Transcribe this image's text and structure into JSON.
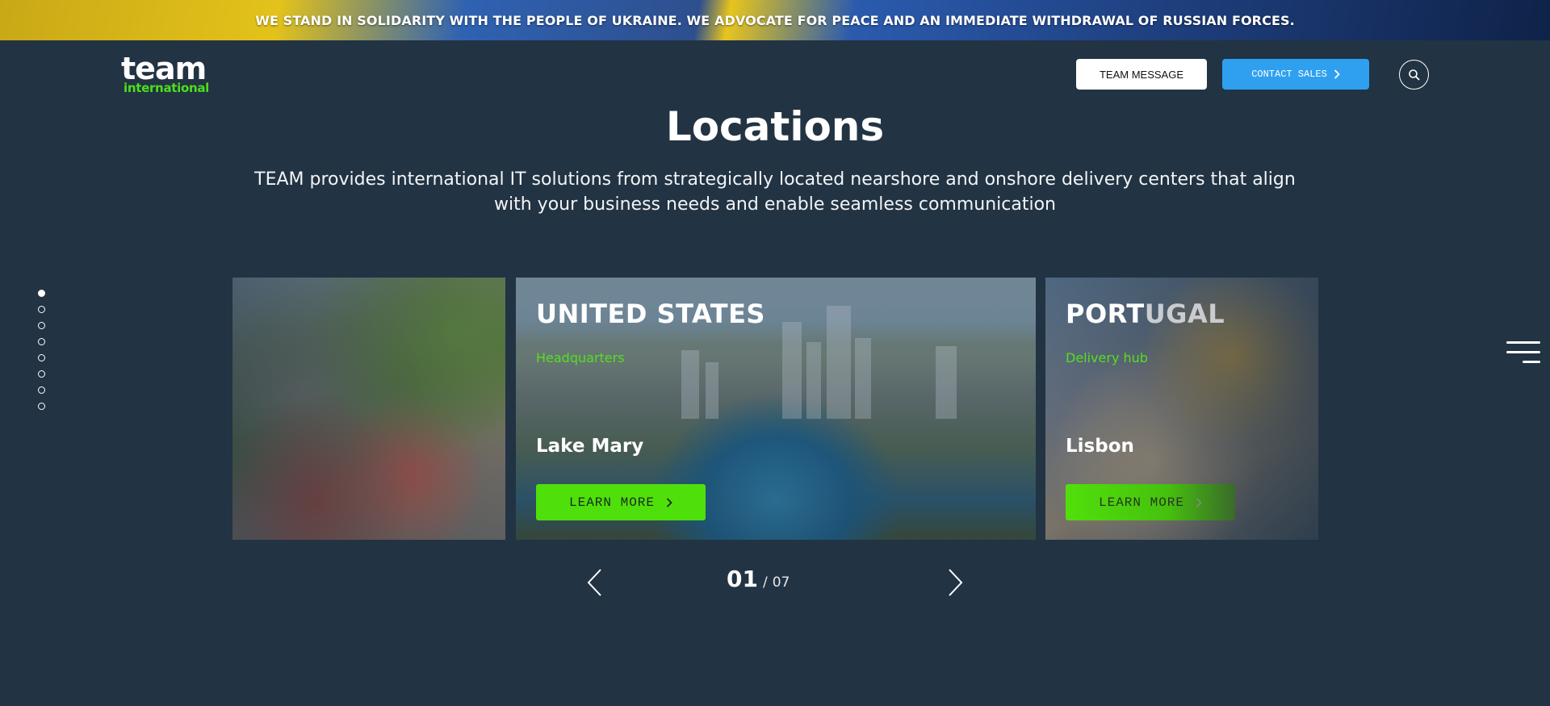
{
  "banner": {
    "text": "WE STAND IN SOLIDARITY WITH THE PEOPLE OF UKRAINE. WE ADVOCATE FOR PEACE AND AN IMMEDIATE WITHDRAWAL OF RUSSIAN FORCES."
  },
  "logo": {
    "line1": "team",
    "line2": "international"
  },
  "header": {
    "team_message": "TEAM MESSAGE",
    "contact_sales": "CONTACT SALES",
    "search_icon": "search-icon"
  },
  "page": {
    "title": "Locations",
    "subtitle": "TEAM provides international IT solutions from strategically located nearshore and onshore delivery centers that align with your business needs and enable seamless communication"
  },
  "side_dots": {
    "count": 8,
    "active_index": 0
  },
  "cards": [
    {
      "country": "",
      "tag": "",
      "city": "",
      "learn": ""
    },
    {
      "country": "UNITED STATES",
      "tag": "Headquarters",
      "city": "Lake Mary",
      "learn": "LEARN MORE"
    },
    {
      "country_a": "PORT",
      "country_b": "UGAL",
      "tag": "Delivery hub",
      "city": "Lisbon",
      "learn": "LEARN MORE"
    }
  ],
  "pager": {
    "current": "01",
    "separator": "/",
    "total": "07"
  },
  "colors": {
    "background": "#223343",
    "accent_green": "#4fe00b",
    "accent_blue": "#2fa0ef"
  }
}
